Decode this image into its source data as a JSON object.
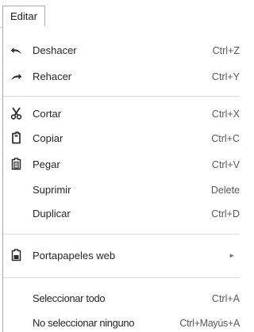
{
  "menubar": {
    "tab_label": "Editar"
  },
  "menu": {
    "items": [
      {
        "label": "Deshacer",
        "shortcut": "Ctrl+Z",
        "icon": "undo-icon"
      },
      {
        "label": "Rehacer",
        "shortcut": "Ctrl+Y",
        "icon": "redo-icon"
      },
      {
        "label": "Cortar",
        "shortcut": "Ctrl+X",
        "icon": "scissors-icon"
      },
      {
        "label": "Copiar",
        "shortcut": "Ctrl+C",
        "icon": "copy-icon"
      },
      {
        "label": "Pegar",
        "shortcut": "Ctrl+V",
        "icon": "paste-icon"
      },
      {
        "label": "Suprimir",
        "shortcut": "Delete"
      },
      {
        "label": "Duplicar",
        "shortcut": "Ctrl+D"
      },
      {
        "label": "Portapapeles web",
        "shortcut": "►",
        "icon": "clipboard-icon"
      },
      {
        "label": "Seleccionar todo",
        "shortcut": "Ctrl+A"
      },
      {
        "label": "No seleccionar ninguno",
        "shortcut": "Ctrl+Mayús+A"
      }
    ]
  }
}
